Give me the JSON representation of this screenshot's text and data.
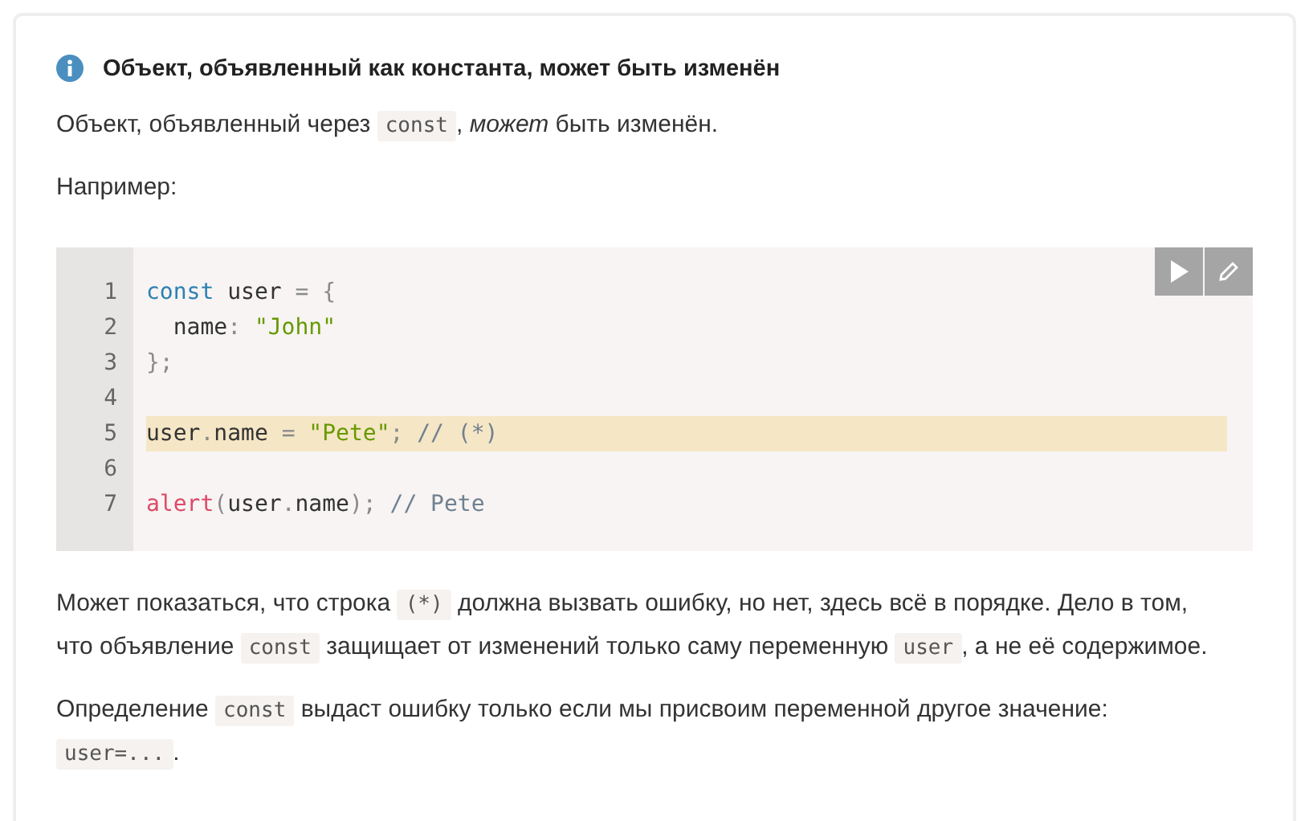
{
  "note": {
    "title": "Объект, объявленный как константа, может быть изменён"
  },
  "paragraphs_before": [
    [
      {
        "kind": "text",
        "text": "Объект, объявленный через "
      },
      {
        "kind": "code",
        "text": "const"
      },
      {
        "kind": "text",
        "text": ", "
      },
      {
        "kind": "em",
        "text": "может"
      },
      {
        "kind": "text",
        "text": " быть изменён."
      }
    ],
    [
      {
        "kind": "text",
        "text": "Например:"
      }
    ]
  ],
  "code_block": {
    "lines": [
      {
        "number": "1",
        "highlighted": false,
        "tokens": [
          {
            "kind": "keyword",
            "text": "const"
          },
          {
            "kind": "plain",
            "text": " user "
          },
          {
            "kind": "punct",
            "text": "= {"
          }
        ]
      },
      {
        "number": "2",
        "highlighted": false,
        "tokens": [
          {
            "kind": "plain",
            "text": "  name"
          },
          {
            "kind": "punct",
            "text": ": "
          },
          {
            "kind": "string",
            "text": "\"John\""
          }
        ]
      },
      {
        "number": "3",
        "highlighted": false,
        "tokens": [
          {
            "kind": "punct",
            "text": "};"
          }
        ]
      },
      {
        "number": "4",
        "highlighted": false
      },
      {
        "number": "5",
        "highlighted": true,
        "tokens": [
          {
            "kind": "plain",
            "text": "user"
          },
          {
            "kind": "punct",
            "text": "."
          },
          {
            "kind": "plain",
            "text": "name "
          },
          {
            "kind": "punct",
            "text": "= "
          },
          {
            "kind": "string",
            "text": "\"Pete\""
          },
          {
            "kind": "punct",
            "text": "; "
          },
          {
            "kind": "comment",
            "text": "// (*)"
          }
        ]
      },
      {
        "number": "6",
        "highlighted": false
      },
      {
        "number": "7",
        "highlighted": false,
        "tokens": [
          {
            "kind": "function",
            "text": "alert"
          },
          {
            "kind": "punct",
            "text": "("
          },
          {
            "kind": "plain",
            "text": "user"
          },
          {
            "kind": "punct",
            "text": "."
          },
          {
            "kind": "plain",
            "text": "name"
          },
          {
            "kind": "punct",
            "text": "); "
          },
          {
            "kind": "comment",
            "text": "// Pete"
          }
        ]
      }
    ],
    "buttons": [
      {
        "kind": "run"
      },
      {
        "kind": "edit"
      }
    ]
  },
  "paragraphs_after": [
    [
      {
        "kind": "text",
        "text": "Может показаться, что строка "
      },
      {
        "kind": "code",
        "text": "(*)"
      },
      {
        "kind": "text",
        "text": " должна вызвать ошибку, но нет, здесь всё в порядке. Дело в том, что объявление "
      },
      {
        "kind": "code",
        "text": "const"
      },
      {
        "kind": "text",
        "text": " защищает от изменений только саму переменную "
      },
      {
        "kind": "code",
        "text": "user"
      },
      {
        "kind": "text",
        "text": ", а не её содержимое."
      }
    ],
    [
      {
        "kind": "text",
        "text": "Определение "
      },
      {
        "kind": "code",
        "text": "const"
      },
      {
        "kind": "text",
        "text": " выдаст ошибку только если мы присвоим переменной другое значение: "
      },
      {
        "kind": "code",
        "text": "user=..."
      },
      {
        "kind": "text",
        "text": "."
      }
    ]
  ]
}
